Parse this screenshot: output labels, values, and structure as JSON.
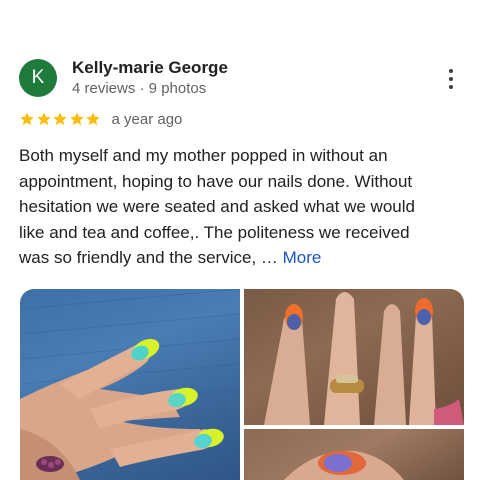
{
  "review": {
    "author": {
      "initial": "K",
      "name": "Kelly-marie George",
      "meta": "4 reviews · 9 photos",
      "avatar_color": "#1e7b3c"
    },
    "rating": 5,
    "max_rating": 5,
    "star_color": "#fbbc04",
    "date": "a year ago",
    "text_lines": [
      "Both myself and my mother popped in without an",
      "appointment, hoping to have our nails done. Without",
      "hesitation we were seated and asked what we would",
      "like and tea and coffee,. The politeness we received"
    ],
    "last_line": "was so friendly and the service, …",
    "more_label": "More",
    "more_color": "#1a56c9"
  },
  "photos": [
    {
      "icon": "photo-icon"
    },
    {
      "icon": "photo-icon"
    },
    {
      "icon": "photo-icon"
    }
  ],
  "icons": {
    "more_options": "more-vert-icon",
    "star": "star-icon"
  }
}
